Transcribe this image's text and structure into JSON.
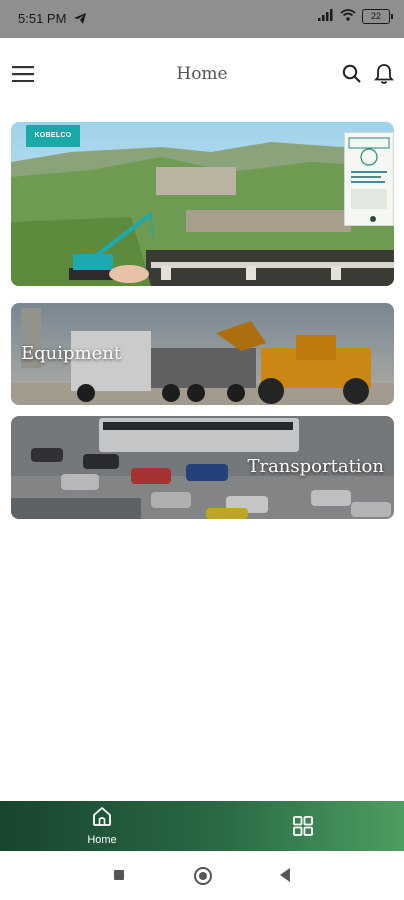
{
  "status_bar": {
    "time": "5:51 PM",
    "battery": "22"
  },
  "header": {
    "title": "Home"
  },
  "banner": {
    "brand_badge": "KOBELCO"
  },
  "categories": [
    {
      "label": "Equipment"
    },
    {
      "label": "Transportation"
    }
  ],
  "bottom_nav": {
    "items": [
      {
        "label": "Home",
        "icon": "home-icon",
        "active": true
      },
      {
        "label": "",
        "icon": "grid-icon",
        "active": false
      }
    ]
  },
  "colors": {
    "status_bar_bg": "#8f8f8f",
    "nav_gradient_start": "#17452f",
    "nav_gradient_end": "#4d9e62",
    "kobelco_badge": "#1aa9a9"
  }
}
